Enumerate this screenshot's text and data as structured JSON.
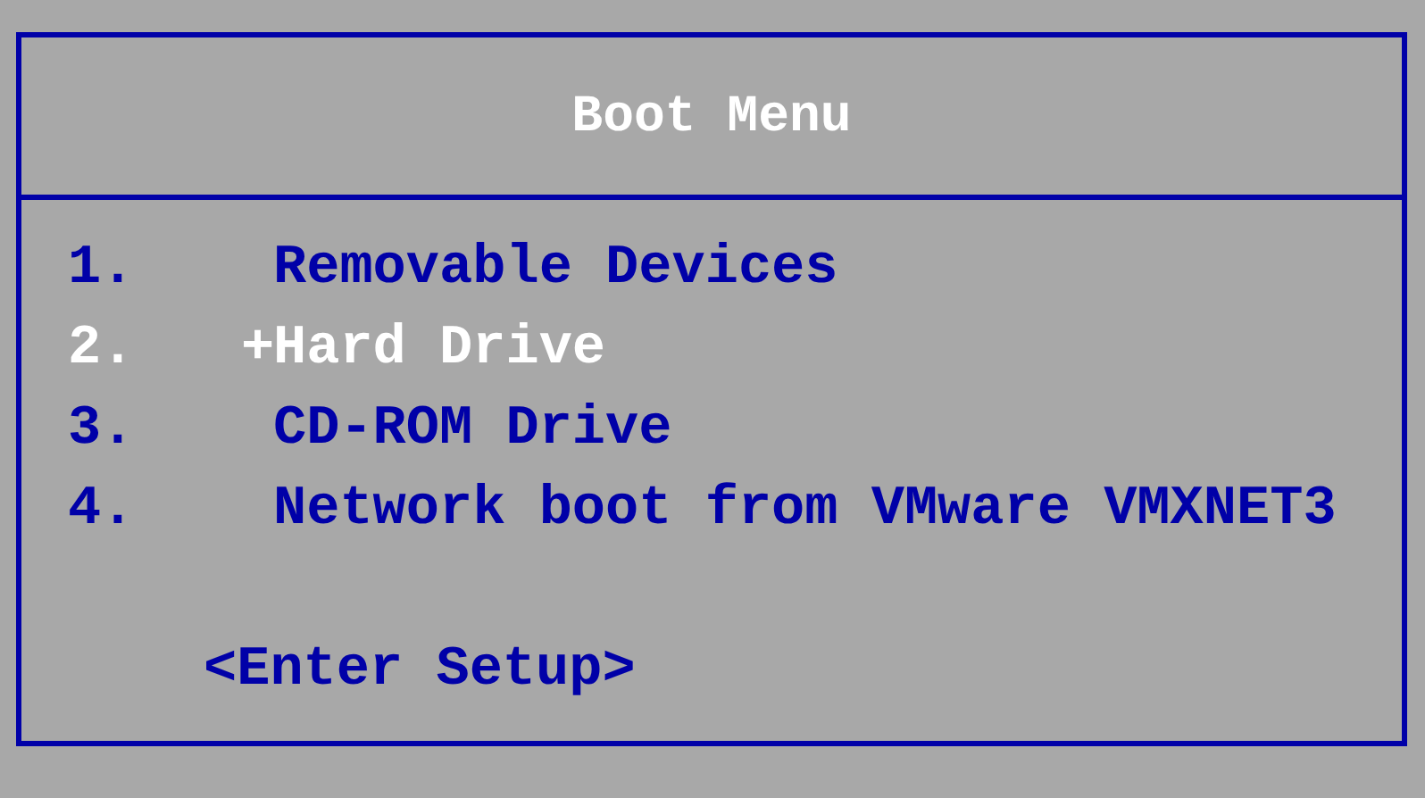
{
  "title": "Boot Menu",
  "items": [
    {
      "number": "1.",
      "label": "Removable Devices",
      "selected": false
    },
    {
      "number": "2.",
      "marker": "+",
      "label": "Hard Drive",
      "selected": true
    },
    {
      "number": "3.",
      "label": "CD-ROM Drive",
      "selected": false
    },
    {
      "number": "4.",
      "label": "Network boot from VMware VMXNET3",
      "selected": false
    }
  ],
  "setup": "<Enter Setup>"
}
